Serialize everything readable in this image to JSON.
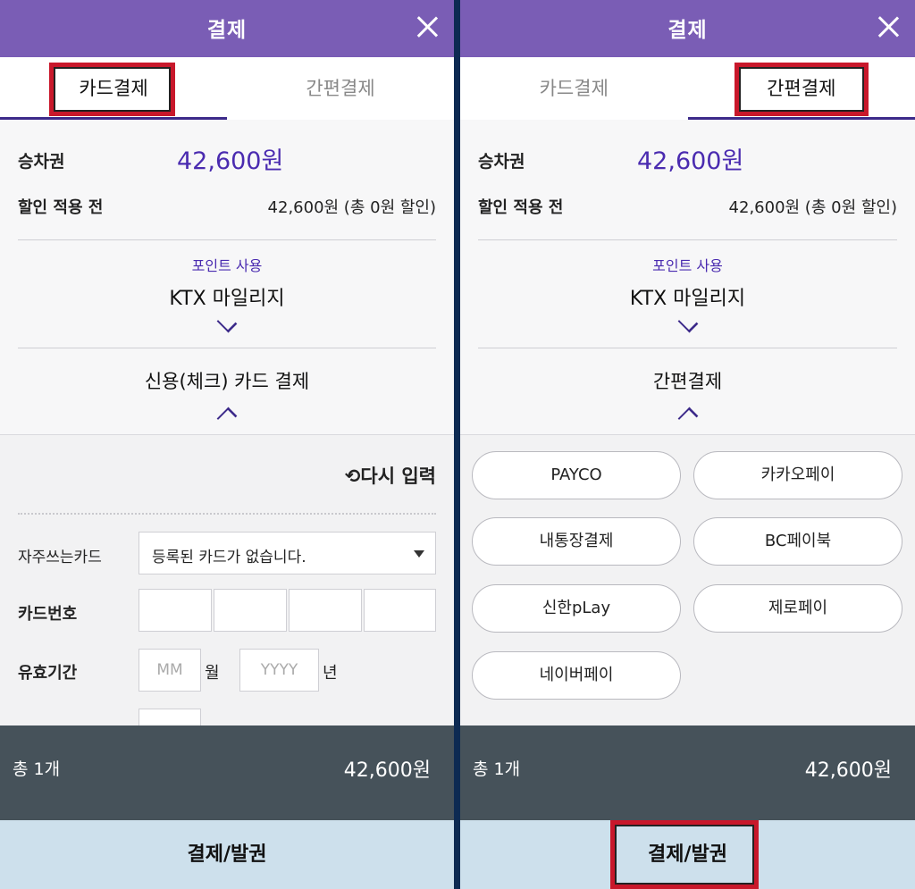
{
  "left": {
    "header": {
      "title": "결제"
    },
    "tabs": [
      {
        "label": "카드결제",
        "active": true
      },
      {
        "label": "간편결제",
        "active": false
      }
    ],
    "ticket": {
      "label": "승차권",
      "amount": "42,600원"
    },
    "before_discount": {
      "label": "할인 적용 전",
      "value": "42,600원 (총 0원 할인)"
    },
    "points": {
      "caption": "포인트 사용",
      "title": "KTX 마일리지"
    },
    "method": {
      "title": "신용(체크) 카드 결제"
    },
    "form": {
      "reinput_label": "⟲다시 입력",
      "frequent_card_label": "자주쓰는카드",
      "frequent_card_value": "등록된 카드가 없습니다.",
      "card_number_label": "카드번호",
      "expiry_label": "유효기간",
      "month_placeholder": "MM",
      "month_unit": "월",
      "year_placeholder": "YYYY",
      "year_unit": "년"
    },
    "total": {
      "count": "총 1개",
      "amount": "42,600원"
    },
    "pay_button": "결제/발권"
  },
  "right": {
    "header": {
      "title": "결제"
    },
    "tabs": [
      {
        "label": "카드결제",
        "active": false
      },
      {
        "label": "간편결제",
        "active": true
      }
    ],
    "ticket": {
      "label": "승차권",
      "amount": "42,600원"
    },
    "before_discount": {
      "label": "할인 적용 전",
      "value": "42,600원 (총 0원 할인)"
    },
    "points": {
      "caption": "포인트 사용",
      "title": "KTX 마일리지"
    },
    "method": {
      "title": "간편결제"
    },
    "easy_pay_options": [
      "PAYCO",
      "카카오페이",
      "내통장결제",
      "BC페이북",
      "신한pLay",
      "제로페이",
      "네이버페이"
    ],
    "total": {
      "count": "총 1개",
      "amount": "42,600원"
    },
    "pay_button": "결제/발권"
  },
  "colors": {
    "header": "#7a5db5",
    "accent": "#4a2bb0",
    "highlight": "#c8182b",
    "total_bar": "#46525a",
    "pay_button": "#cde0ec"
  }
}
